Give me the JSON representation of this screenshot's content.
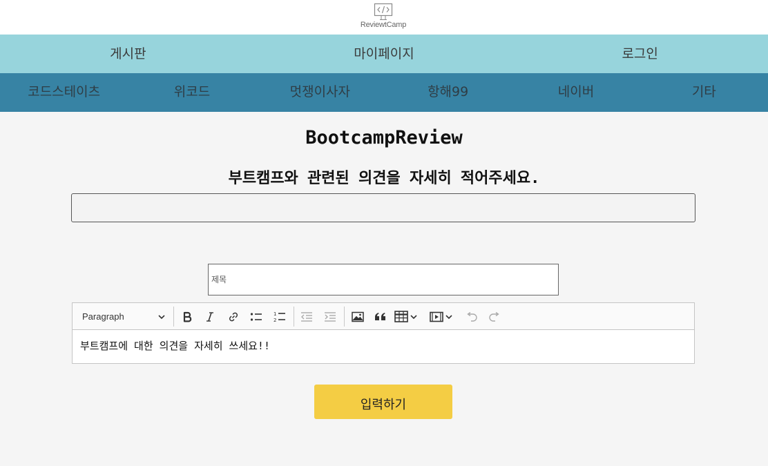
{
  "logo": {
    "text": "ReviewtCamp",
    "icon": "code-brackets-icon"
  },
  "main_nav": [
    {
      "label": "게시판"
    },
    {
      "label": "마이페이지"
    },
    {
      "label": "로그인"
    }
  ],
  "sub_nav": [
    {
      "label": "코드스테이츠"
    },
    {
      "label": "위코드"
    },
    {
      "label": "멋쟁이사자"
    },
    {
      "label": "항해99"
    },
    {
      "label": "네이버"
    },
    {
      "label": "기타"
    }
  ],
  "page": {
    "title": "BootcampReview",
    "subtitle": "부트캠프와 관련된 의견을 자세히 적어주세요.",
    "bootcamp_input_value": ""
  },
  "form": {
    "title_placeholder": "제목",
    "title_value": ""
  },
  "editor": {
    "heading_select": "Paragraph",
    "content": "부트캠프에 대한 의견을 자세히 쓰세요!!",
    "toolbar_icons": [
      "bold-icon",
      "italic-icon",
      "link-icon",
      "bulleted-list-icon",
      "numbered-list-icon",
      "outdent-icon",
      "indent-icon",
      "image-icon",
      "quote-icon",
      "table-icon",
      "media-icon",
      "undo-icon",
      "redo-icon"
    ]
  },
  "submit": {
    "label": "입력하기"
  },
  "colors": {
    "main_nav_bg": "#97d4dc",
    "sub_nav_bg": "#3783a4",
    "button_bg": "#f4cd44",
    "page_bg": "#f5f5f5"
  }
}
